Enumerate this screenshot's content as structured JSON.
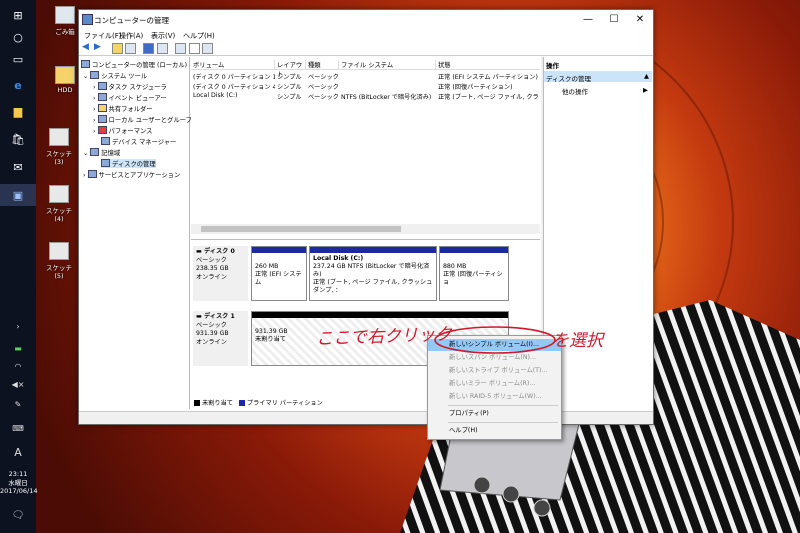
{
  "taskbar": {
    "time": "23:11",
    "weekday": "水曜日",
    "date": "2017/06/14",
    "ime": "A",
    "icons": [
      "windows-icon",
      "cortana-icon",
      "task-view-icon",
      "edge-icon",
      "explorer-icon",
      "store-icon",
      "mail-icon",
      "computer-management-icon"
    ]
  },
  "desktop": {
    "icons": [
      {
        "label": "ごみ箱"
      },
      {
        "label": "HDD"
      },
      {
        "label": "スケッチ (3)"
      },
      {
        "label": "スケッチ (4)"
      },
      {
        "label": "スケッチ (5)"
      }
    ]
  },
  "window": {
    "title": "コンピューターの管理",
    "controls": {
      "minimize": "—",
      "maximize": "☐",
      "close": "✕"
    },
    "menu": [
      "ファイル(F)",
      "操作(A)",
      "表示(V)",
      "ヘルプ(H)"
    ],
    "tree": [
      {
        "label": "コンピューターの管理 (ローカル)",
        "level": 0
      },
      {
        "label": "システム ツール",
        "level": 1
      },
      {
        "label": "タスク スケジューラ",
        "level": 2
      },
      {
        "label": "イベント ビューアー",
        "level": 2
      },
      {
        "label": "共有フォルダー",
        "level": 2
      },
      {
        "label": "ローカル ユーザーとグループ",
        "level": 2
      },
      {
        "label": "パフォーマンス",
        "level": 2
      },
      {
        "label": "デバイス マネージャー",
        "level": 2
      },
      {
        "label": "記憶域",
        "level": 1
      },
      {
        "label": "ディスクの管理",
        "level": 2,
        "selected": true
      },
      {
        "label": "サービスとアプリケーション",
        "level": 1
      }
    ],
    "volume_table": {
      "headers": [
        "ボリューム",
        "レイアウト",
        "種類",
        "ファイル システム",
        "状態"
      ],
      "rows": [
        [
          "(ディスク 0 パーティション 1)",
          "シンプル",
          "ベーシック",
          "",
          "正常 (EFI システム パーティション)"
        ],
        [
          "(ディスク 0 パーティション 4)",
          "シンプル",
          "ベーシック",
          "",
          "正常 (回復パーティション)"
        ],
        [
          "Local Disk (C:)",
          "シンプル",
          "ベーシック",
          "NTFS (BitLocker で暗号化済み)",
          "正常 (ブート, ページ ファイル, クラッシュ"
        ]
      ]
    },
    "disks": [
      {
        "name": "ディスク 0",
        "type": "ベーシック",
        "size": "238.35 GB",
        "status": "オンライン",
        "partitions": [
          {
            "title": "",
            "size": "260 MB",
            "status": "正常 (EFI システム"
          },
          {
            "title": "Local Disk  (C:)",
            "size": "237.24 GB NTFS (BitLocker で暗号化済み)",
            "status": "正常 (ブート, ページ ファイル, クラッシュ ダンプ, ："
          },
          {
            "title": "",
            "size": "880 MB",
            "status": "正常 (回復パーティショ"
          }
        ]
      },
      {
        "name": "ディスク 1",
        "type": "ベーシック",
        "size": "931.39 GB",
        "status": "オンライン",
        "partitions": [
          {
            "title": "",
            "size": "931.39 GB",
            "status": "未割り当て"
          }
        ]
      }
    ],
    "legend": [
      {
        "label": "未割り当て",
        "color": "#000000"
      },
      {
        "label": "プライマリ パーティション",
        "color": "#1c2aa0"
      }
    ],
    "actions": {
      "header": "操作",
      "selected": "ディスクの管理",
      "items": [
        "他の操作"
      ]
    }
  },
  "context_menu": {
    "items": [
      {
        "label": "新しいシンプル ボリューム(I)...",
        "enabled": true,
        "highlighted": true
      },
      {
        "label": "新しいスパン ボリューム(N)...",
        "enabled": false
      },
      {
        "label": "新しいストライプ ボリューム(T)...",
        "enabled": false
      },
      {
        "label": "新しいミラー ボリューム(R)...",
        "enabled": false
      },
      {
        "label": "新しい RAID-5 ボリューム(W)...",
        "enabled": false
      },
      {
        "label": "プロパティ(P)",
        "enabled": true
      },
      {
        "label": "ヘルプ(H)",
        "enabled": true
      }
    ]
  },
  "annotation": {
    "text1": "ここで右クリック",
    "text2": "を選択",
    "color": "#d0182c"
  }
}
